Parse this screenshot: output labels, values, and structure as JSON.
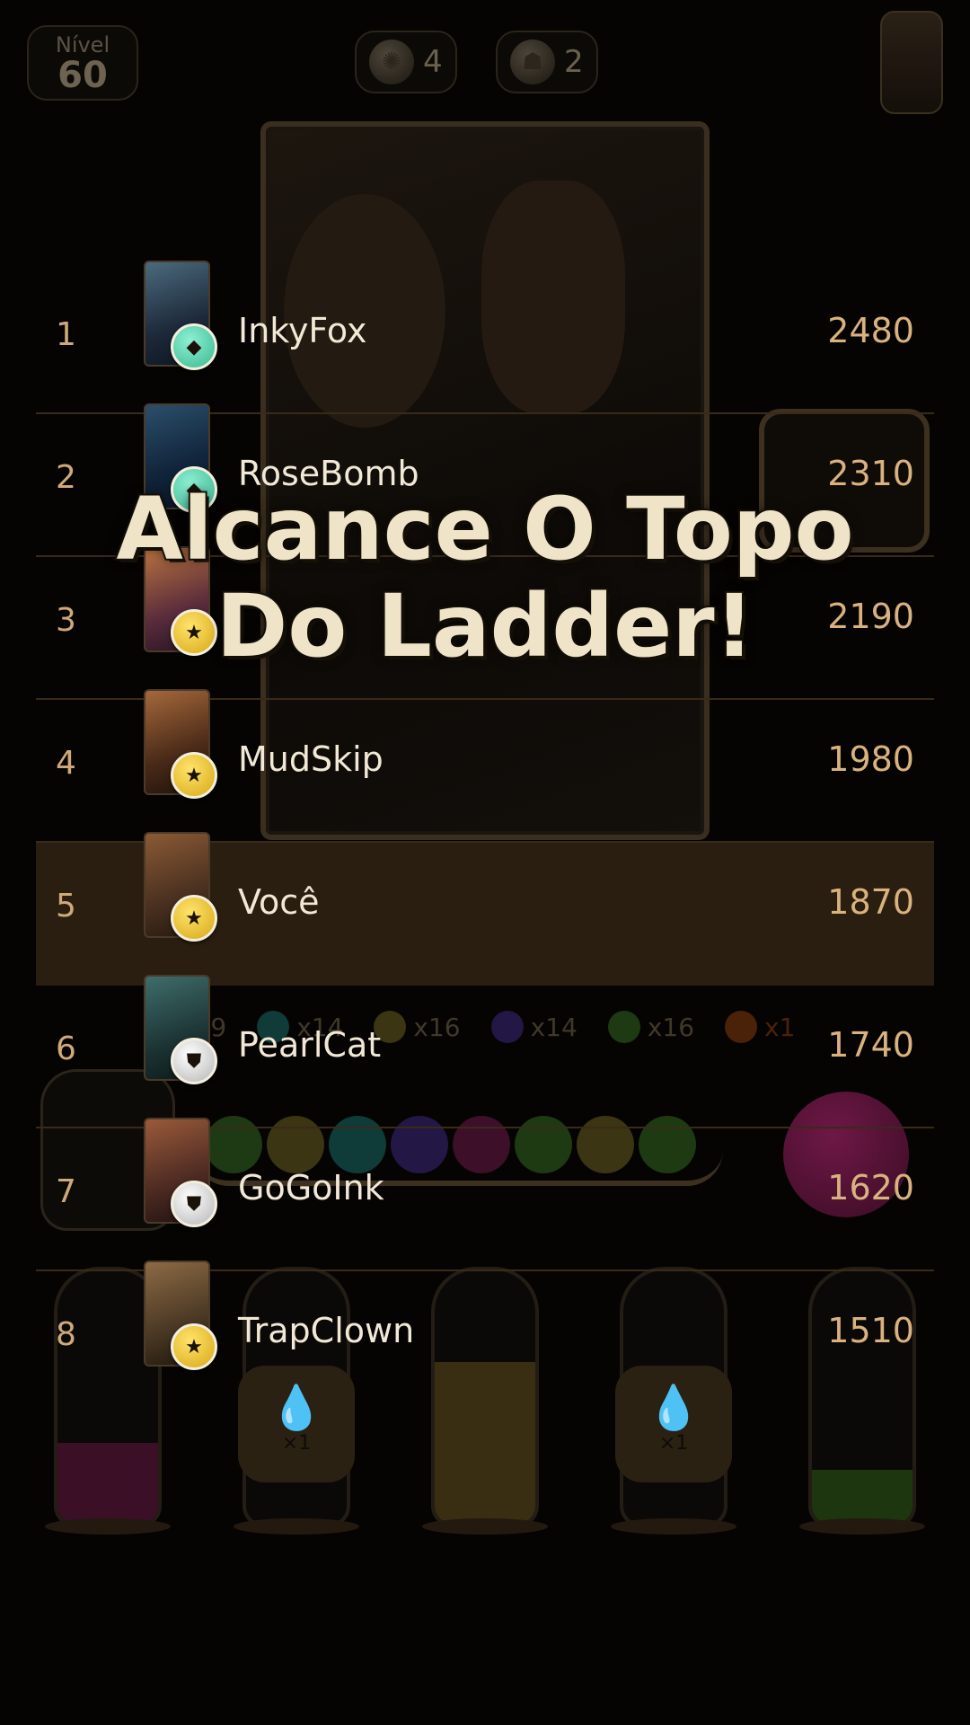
{
  "hud": {
    "level_label": "Nível",
    "level_value": "60",
    "pill_1_count": "4",
    "pill_1_icon": "octopus-icon",
    "pill_2_count": "2",
    "pill_2_icon": "robot-head-icon"
  },
  "headline": {
    "line1": "Alcance O Topo",
    "line2": "Do Ladder!"
  },
  "leaderboard": {
    "rows": [
      {
        "rank": "1",
        "name": "InkyFox",
        "score": "2480",
        "badge": "gem"
      },
      {
        "rank": "2",
        "name": "RoseBomb",
        "score": "2310",
        "badge": "gem"
      },
      {
        "rank": "3",
        "name": "",
        "score": "2190",
        "badge": "gold"
      },
      {
        "rank": "4",
        "name": "MudSkip",
        "score": "1980",
        "badge": "gold"
      },
      {
        "rank": "5",
        "name": "Você",
        "score": "1870",
        "badge": "gold"
      },
      {
        "rank": "6",
        "name": "PearlCat",
        "score": "1740",
        "badge": "silver"
      },
      {
        "rank": "7",
        "name": "GoGoInk",
        "score": "1620",
        "badge": "silver"
      },
      {
        "rank": "8",
        "name": "TrapClown",
        "score": "1510",
        "badge": "gold"
      }
    ]
  },
  "background_counts": {
    "items": [
      {
        "label": "x19",
        "color": "#12342f"
      },
      {
        "label": "x14",
        "color": "#0f3b38"
      },
      {
        "label": "x16",
        "color": "#3b3513"
      },
      {
        "label": "x14",
        "color": "#231745"
      },
      {
        "label": "x16",
        "color": "#1e3a12"
      },
      {
        "label": "x1",
        "color": "#4a2208"
      }
    ]
  },
  "drop_badges": {
    "left": "×1",
    "right": "×1"
  },
  "colors": {
    "score": "#d9b27e",
    "rank": "#cfa97a",
    "highlight_row": "#2a1e10",
    "divider": "#3a2a18",
    "headline_fill": "#efe3c8"
  }
}
